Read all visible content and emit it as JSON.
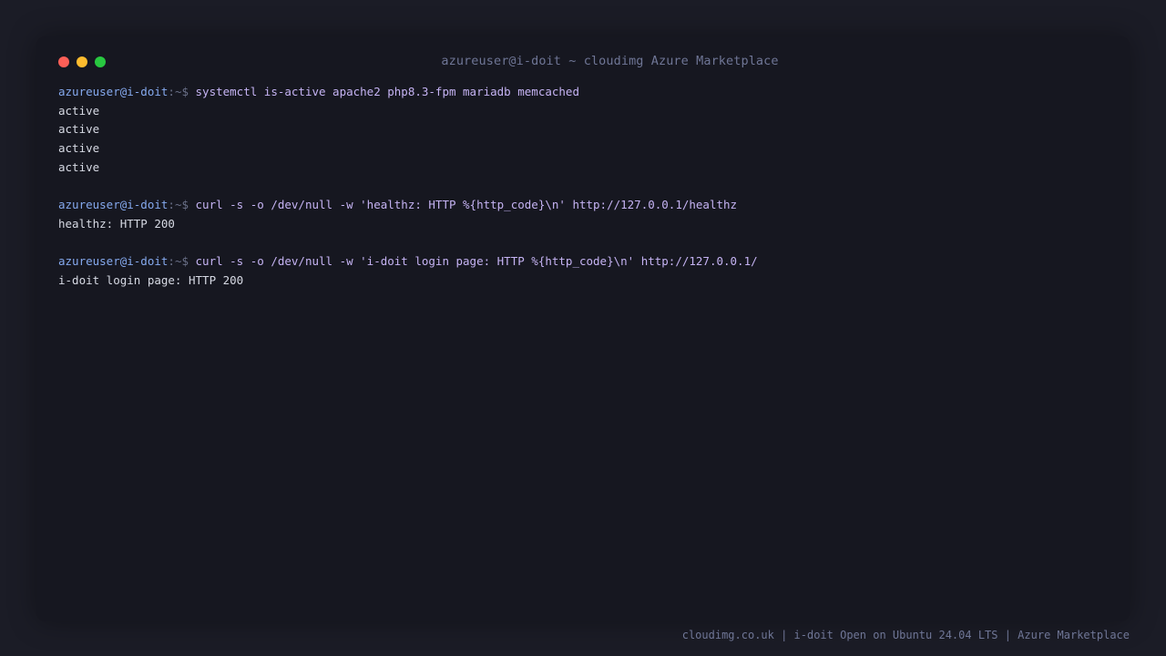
{
  "window": {
    "title": "azureuser@i-doit ~ cloudimg Azure Marketplace"
  },
  "prompt": {
    "user_host": "azureuser@i-doit",
    "path_symbol": ":~$"
  },
  "session": [
    {
      "command": "systemctl is-active apache2 php8.3-fpm mariadb memcached",
      "output": [
        "active",
        "active",
        "active",
        "active"
      ]
    },
    {
      "command": "curl -s -o /dev/null -w 'healthz: HTTP %{http_code}\\n' http://127.0.0.1/healthz",
      "output": [
        "healthz: HTTP 200"
      ]
    },
    {
      "command": "curl -s -o /dev/null -w 'i-doit login page: HTTP %{http_code}\\n' http://127.0.0.1/",
      "output": [
        "i-doit login page: HTTP 200"
      ]
    }
  ],
  "footer": {
    "text": "cloudimg.co.uk | i-doit Open on Ubuntu 24.04 LTS | Azure Marketplace"
  },
  "colors": {
    "background": "#1b1c26",
    "window": "#161720",
    "prompt_user": "#85a9ee",
    "command": "#c5b3f3",
    "output": "#d6d9e3",
    "muted": "#6f7696",
    "close": "#fe5f57",
    "minimize": "#febc2e",
    "maximize": "#28c840"
  }
}
